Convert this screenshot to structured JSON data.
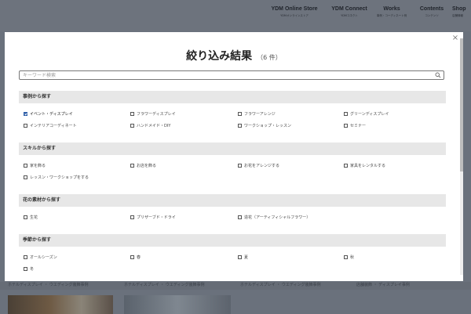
{
  "nav": [
    {
      "title": "YDM Online Store",
      "sub": "YDMオンラインストア"
    },
    {
      "title": "YDM Connect",
      "sub": "YDMコネクト"
    },
    {
      "title": "Works",
      "sub": "事例・コーディネート例"
    },
    {
      "title": "Contents",
      "sub": "コンテンツ"
    },
    {
      "title": "Shop",
      "sub": "店舗情報"
    }
  ],
  "background": {
    "strip_texts": [
      "ホテルディスプレイ ・ ウエディング装飾事例",
      "ホテルディスプレイ ・ ウエディング装飾事例",
      "ホテルディスプレイ ・ ウエディング装飾事例",
      "店舗装飾 ・ ディスプレイ事例"
    ]
  },
  "modal": {
    "close_glyph": "×",
    "title": "絞り込み結果",
    "count": "（6 件）",
    "search_placeholder": "キーワード検索",
    "sections": [
      {
        "heading": "事例から探す",
        "options": [
          {
            "label": "イベント・ディスプレイ",
            "checked": true
          },
          {
            "label": "フラワーディスプレイ",
            "checked": false
          },
          {
            "label": "フラワーアレンジ",
            "checked": false
          },
          {
            "label": "グリーンディスプレイ",
            "checked": false
          },
          {
            "label": "インテリアコーディネート",
            "checked": false
          },
          {
            "label": "ハンドメイド・DIY",
            "checked": false
          },
          {
            "label": "ワークショップ・レッスン",
            "checked": false
          },
          {
            "label": "セミナー",
            "checked": false
          }
        ]
      },
      {
        "heading": "スキルから探す",
        "options": [
          {
            "label": "家を飾る",
            "checked": false
          },
          {
            "label": "お店を飾る",
            "checked": false
          },
          {
            "label": "お花をアレンジする",
            "checked": false
          },
          {
            "label": "家具をレンタルする",
            "checked": false
          },
          {
            "label": "レッスン・ワークショップをする",
            "checked": false
          }
        ]
      },
      {
        "heading": "花の素材から探す",
        "options": [
          {
            "label": "生花",
            "checked": false
          },
          {
            "label": "プリザーブド・ドライ",
            "checked": false
          },
          {
            "label": "造花（アーティフィシャルフラワー）",
            "checked": false
          }
        ]
      },
      {
        "heading": "季節から探す",
        "options": [
          {
            "label": "オールシーズン",
            "checked": false
          },
          {
            "label": "春",
            "checked": false
          },
          {
            "label": "夏",
            "checked": false
          },
          {
            "label": "秋",
            "checked": false
          },
          {
            "label": "冬",
            "checked": false
          }
        ]
      }
    ]
  },
  "colors": {
    "accent": "#2f5fa8",
    "section_bg": "#e7e7e7",
    "overlay": "#6a717c"
  }
}
